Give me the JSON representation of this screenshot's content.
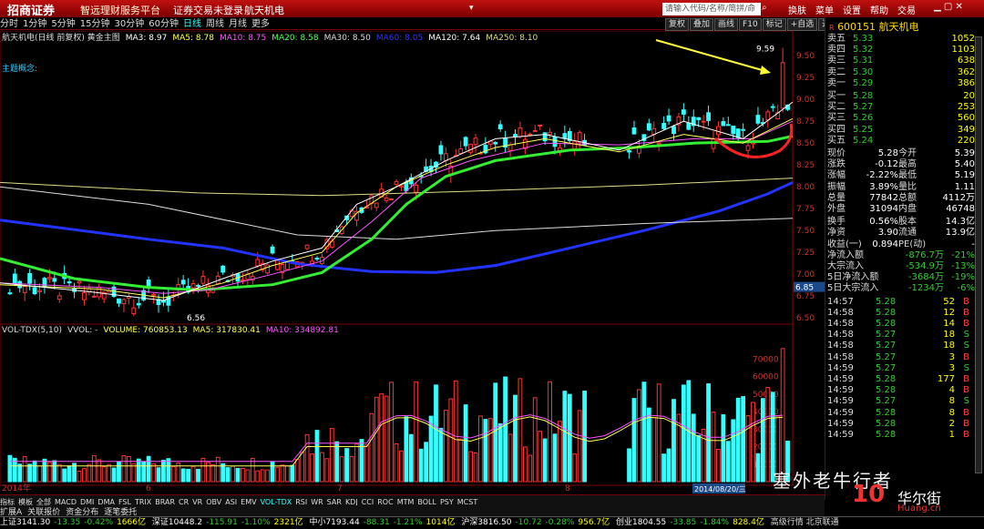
{
  "titlebar": {
    "logo": "招商证券",
    "slogan": "智远理财服务平台",
    "login": "证券交易未登录",
    "stock_name": "航天机电",
    "search_placeholder": "请输入代码/名称/简拼/命令",
    "menu": [
      "换肤",
      "菜单",
      "设置",
      "帮助",
      "交易"
    ]
  },
  "periods": [
    "分时",
    "1分钟",
    "5分钟",
    "15分钟",
    "30分钟",
    "60分钟",
    "日线",
    "周线",
    "月线",
    "更多"
  ],
  "selected_period": "日线",
  "tool_buttons": [
    "复权",
    "叠加",
    "画线",
    "F10",
    "标记",
    "+自选",
    "返回"
  ],
  "ma_legend": [
    {
      "text": "航天机电(日线 前复权) 黄金主图",
      "color": "#dddddd"
    },
    {
      "text": "MA3: 8.97",
      "color": "#ffffff"
    },
    {
      "text": "MA5: 8.78",
      "color": "#ffff55"
    },
    {
      "text": "MA10: 8.75",
      "color": "#ff55ff"
    },
    {
      "text": "MA20: 8.58",
      "color": "#55ff55"
    },
    {
      "text": "MA30: 8.50",
      "color": "#dddddd"
    },
    {
      "text": "MA60: 8.05",
      "color": "#3333ff"
    },
    {
      "text": "MA120: 7.64",
      "color": "#ffffff"
    },
    {
      "text": "MA250: 8.10",
      "color": "#dddd88"
    }
  ],
  "concept_label": "主题概念:",
  "vol_legend": [
    {
      "text": "VOL-TDX(5,10)",
      "color": "#dddddd"
    },
    {
      "text": "VVOL: -",
      "color": "#dddddd"
    },
    {
      "text": "VOLUME: 760853.13",
      "color": "#ffff55"
    },
    {
      "text": "MA5: 317830.41",
      "color": "#ffff55"
    },
    {
      "text": "MA10: 334892.81",
      "color": "#ff55ff"
    }
  ],
  "chart_data": {
    "type": "candlestick",
    "price_axis": {
      "ticks": [
        "9.50",
        "9.25",
        "9.00",
        "8.75",
        "8.50",
        "8.25",
        "8.00",
        "7.75",
        "7.50",
        "7.25",
        "7.00",
        "6.75",
        "6.50"
      ],
      "range": [
        6.45,
        9.7
      ]
    },
    "volume_axis": {
      "ticks": [
        "70000",
        "60000",
        "50000",
        "40000",
        "30000",
        "20000",
        "10000"
      ],
      "range": [
        0,
        78000
      ]
    },
    "annotations": {
      "high": "9.59",
      "low": "6.56",
      "current": "6.85",
      "x_labels": [
        "2014年",
        "6",
        "7",
        "8"
      ],
      "date_tag": "2014/08/20/三"
    },
    "ma_curves": [
      {
        "name": "MA60",
        "color": "#2233ff",
        "points": [
          [
            0,
            7.62
          ],
          [
            15,
            7.51
          ],
          [
            30,
            7.4
          ],
          [
            45,
            7.3
          ],
          [
            60,
            7.12
          ],
          [
            75,
            7.03
          ],
          [
            88,
            7.02
          ],
          [
            100,
            7.1
          ],
          [
            115,
            7.3
          ],
          [
            130,
            7.5
          ],
          [
            145,
            7.72
          ],
          [
            155,
            7.92
          ],
          [
            160,
            8.05
          ]
        ]
      },
      {
        "name": "MA250",
        "color": "#dddd88",
        "points": [
          [
            0,
            8.05
          ],
          [
            40,
            7.93
          ],
          [
            65,
            7.9
          ],
          [
            95,
            7.95
          ],
          [
            130,
            8.02
          ],
          [
            160,
            8.1
          ]
        ]
      },
      {
        "name": "MA120",
        "color": "#dddddd",
        "points": [
          [
            0,
            8.0
          ],
          [
            30,
            7.8
          ],
          [
            60,
            7.45
          ],
          [
            80,
            7.4
          ],
          [
            100,
            7.5
          ],
          [
            130,
            7.58
          ],
          [
            160,
            7.64
          ]
        ]
      },
      {
        "name": "MA20",
        "color": "#33ee33",
        "points": [
          [
            0,
            7.18
          ],
          [
            15,
            6.95
          ],
          [
            30,
            6.85
          ],
          [
            40,
            6.82
          ],
          [
            55,
            6.88
          ],
          [
            65,
            7.02
          ],
          [
            75,
            7.4
          ],
          [
            82,
            7.8
          ],
          [
            90,
            8.12
          ],
          [
            100,
            8.3
          ],
          [
            115,
            8.42
          ],
          [
            128,
            8.45
          ],
          [
            140,
            8.5
          ],
          [
            155,
            8.52
          ],
          [
            160,
            8.58
          ]
        ]
      },
      {
        "name": "MA10",
        "color": "#ff55ff",
        "points": [
          [
            0,
            6.9
          ],
          [
            20,
            6.85
          ],
          [
            33,
            6.78
          ],
          [
            42,
            6.82
          ],
          [
            55,
            7.0
          ],
          [
            65,
            7.15
          ],
          [
            75,
            7.6
          ],
          [
            85,
            8.1
          ],
          [
            95,
            8.3
          ],
          [
            110,
            8.5
          ],
          [
            125,
            8.48
          ],
          [
            140,
            8.55
          ],
          [
            152,
            8.55
          ],
          [
            160,
            8.75
          ]
        ]
      },
      {
        "name": "MA5",
        "color": "#ffff55",
        "points": [
          [
            0,
            6.88
          ],
          [
            20,
            6.83
          ],
          [
            33,
            6.73
          ],
          [
            45,
            6.9
          ],
          [
            55,
            7.1
          ],
          [
            65,
            7.25
          ],
          [
            72,
            7.7
          ],
          [
            80,
            8.0
          ],
          [
            90,
            8.25
          ],
          [
            100,
            8.45
          ],
          [
            110,
            8.55
          ],
          [
            125,
            8.4
          ],
          [
            138,
            8.6
          ],
          [
            150,
            8.5
          ],
          [
            160,
            8.78
          ]
        ]
      },
      {
        "name": "MA3",
        "color": "#ffffff",
        "points": [
          [
            0,
            6.9
          ],
          [
            18,
            6.8
          ],
          [
            33,
            6.7
          ],
          [
            45,
            6.95
          ],
          [
            55,
            7.15
          ],
          [
            65,
            7.3
          ],
          [
            72,
            7.8
          ],
          [
            80,
            8.0
          ],
          [
            90,
            8.3
          ],
          [
            100,
            8.55
          ],
          [
            110,
            8.6
          ],
          [
            125,
            8.42
          ],
          [
            138,
            8.75
          ],
          [
            150,
            8.55
          ],
          [
            160,
            8.97
          ]
        ]
      }
    ]
  },
  "quote": {
    "code": "600151",
    "name": "航天机电",
    "asks": [
      [
        "卖五",
        "5.33",
        "1052"
      ],
      [
        "卖四",
        "5.32",
        "1103"
      ],
      [
        "卖三",
        "5.31",
        "638"
      ],
      [
        "卖二",
        "5.30",
        "362"
      ],
      [
        "卖一",
        "5.29",
        "386"
      ]
    ],
    "bids": [
      [
        "买一",
        "5.28",
        "20"
      ],
      [
        "买二",
        "5.27",
        "253"
      ],
      [
        "买三",
        "5.26",
        "560"
      ],
      [
        "买四",
        "5.25",
        "349"
      ],
      [
        "买五",
        "5.24",
        "220"
      ]
    ],
    "stats": [
      [
        "现价",
        "5.28",
        "今开",
        "5.39"
      ],
      [
        "涨跌",
        "-0.12",
        "最高",
        "5.40"
      ],
      [
        "涨幅",
        "-2.22%",
        "最低",
        "5.19"
      ],
      [
        "振幅",
        "3.89%",
        "量比",
        "1.11"
      ],
      [
        "总量",
        "77842",
        "总额",
        "4112万"
      ],
      [
        "外盘",
        "31094",
        "内盘",
        "46748"
      ]
    ],
    "stats2": [
      [
        "换手",
        "0.56%",
        "股本",
        "14.3亿"
      ],
      [
        "净资",
        "3.90",
        "流通",
        "13.9亿"
      ],
      [
        "收益(一)",
        "0.894",
        "PE(动)",
        "-"
      ]
    ],
    "flows": [
      [
        "净流入额",
        "-876.7万",
        "-21%"
      ],
      [
        "大宗流入",
        "-534.9万",
        "-13%"
      ],
      [
        "5日净流入额",
        "-3684万",
        "-19%"
      ],
      [
        "5日大宗流入",
        "-1234万",
        "-6%"
      ]
    ],
    "ticks": [
      [
        "14:57",
        "5.28",
        "52",
        "B"
      ],
      [
        "14:58",
        "5.28",
        "12",
        "B"
      ],
      [
        "14:58",
        "5.28",
        "14",
        "B"
      ],
      [
        "14:58",
        "5.27",
        "18",
        "S"
      ],
      [
        "14:58",
        "5.27",
        "18",
        "S"
      ],
      [
        "14:58",
        "5.27",
        "3",
        "B"
      ],
      [
        "14:59",
        "5.27",
        "3",
        "S"
      ],
      [
        "14:59",
        "5.28",
        "177",
        "B"
      ],
      [
        "14:59",
        "5.28",
        "4",
        "B"
      ],
      [
        "14:59",
        "5.27",
        "8",
        "S"
      ],
      [
        "14:59",
        "5.28",
        "8",
        "B"
      ],
      [
        "14:59",
        "5.28",
        "2",
        "B"
      ],
      [
        "14:59",
        "5.28",
        "1",
        "B"
      ]
    ]
  },
  "indicator_tabs": [
    "指标",
    "模板",
    "全部",
    "MACD",
    "DMI",
    "DMA",
    "FSL",
    "TRIX",
    "BRAR",
    "CR",
    "VR",
    "OBV",
    "ASI",
    "EMV",
    "VOL-TDX",
    "RSI",
    "WR",
    "SAR",
    "KDJ",
    "CCI",
    "ROC",
    "MTM",
    "BOLL",
    "PSY",
    "MCST"
  ],
  "selected_indicator": "VOL-TDX",
  "bottom_tabs": [
    "扩展A",
    "关联报价",
    "资金分布",
    "逐笔委托"
  ],
  "status": {
    "sh": "上证3141.30",
    "sh_chg": "-13.35",
    "sh_pct": "-0.42%",
    "sh_amt": "1666亿",
    "sz": "深证10448.2",
    "sz_chg": "-115.91",
    "sz_pct": "-1.10%",
    "sz_amt": "2321亿",
    "zx": "中小7193.44",
    "zx_chg": "-88.31",
    "zx_pct": "-1.21%",
    "zx_amt": "1014亿",
    "hs": "沪深3816.50",
    "hs_chg": "-10.72",
    "hs_pct": "-0.28%",
    "hs_amt": "956.7亿",
    "cy": "创业1804.55",
    "cy_chg": "-33.85",
    "cy_pct": "-1.84%",
    "cy_amt": "828.4亿",
    "right": "高级行情 北京联通"
  },
  "watermark": {
    "text": "塞外老牛行者",
    "logo": "10",
    "site": "Huang.cn",
    "brand": "华尔街"
  }
}
